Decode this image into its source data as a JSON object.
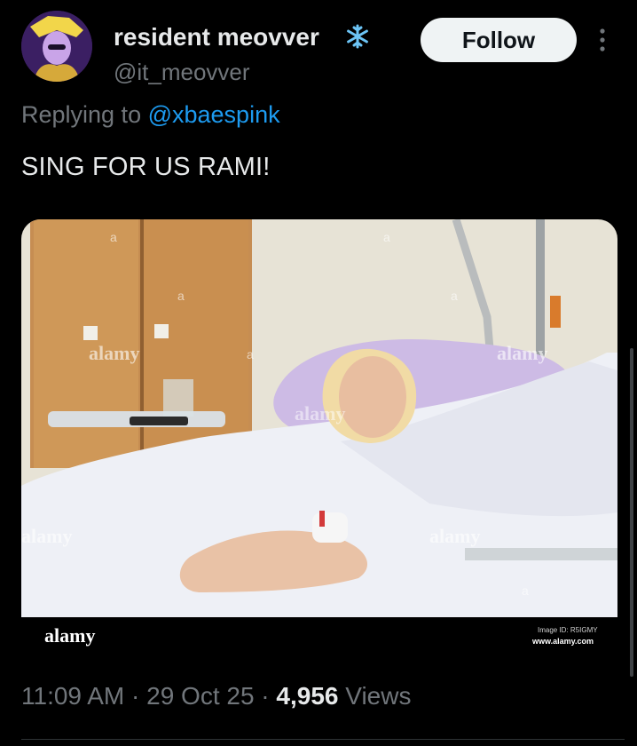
{
  "user": {
    "display_name": "resident meovver",
    "badge_icon": "snowflake-icon",
    "handle": "@it_meovver",
    "avatar_icon": "avatar-image"
  },
  "follow_label": "Follow",
  "more_icon": "more-vertical-icon",
  "reply": {
    "prefix": "Replying to ",
    "handle": "@xbaespink"
  },
  "tweet_text": "SING FOR US RAMI!",
  "media": {
    "watermark_logo": "alamy",
    "watermark_small": "a",
    "image_id": "Image ID: R5IGMY",
    "site": "www.alamy.com"
  },
  "meta": {
    "time": "11:09 AM",
    "sep1": " · ",
    "date": "29 Oct 25",
    "sep2": " · ",
    "views_count": "4,956",
    "views_label": " Views"
  },
  "colors": {
    "background": "#000000",
    "text": "#e7e9ea",
    "muted": "#71767b",
    "link": "#1d9bf0",
    "follow_bg": "#eff3f4"
  }
}
